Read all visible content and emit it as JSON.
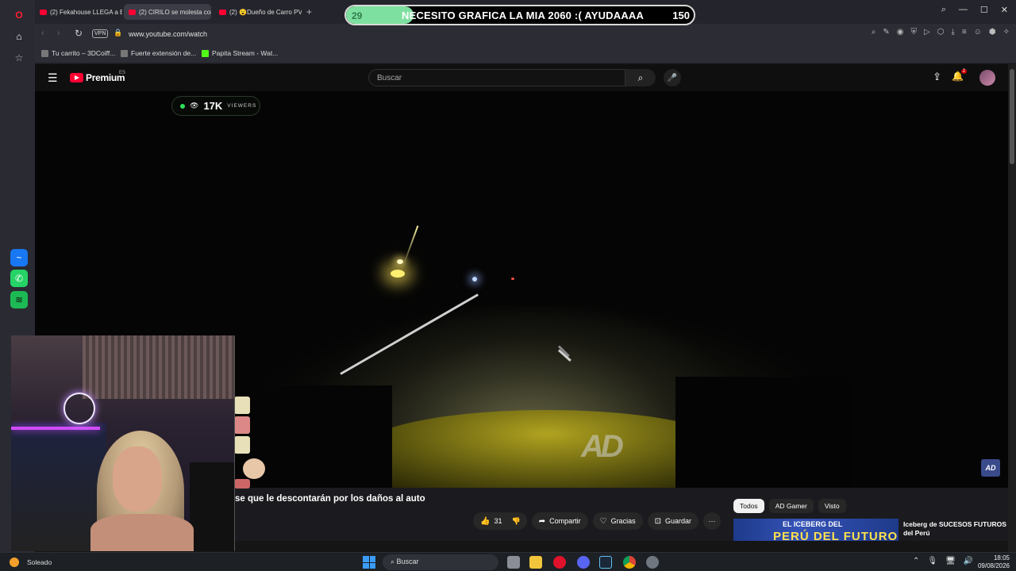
{
  "browser": {
    "tabs": [
      {
        "label": "(2) Fekahouse LLEGA a Bo"
      },
      {
        "label": "(2) CIRILO se molesta con"
      },
      {
        "label": "(2) 😮Dueño de Carro PV"
      }
    ],
    "url": "www.youtube.com/watch",
    "vpn_label": "VPN",
    "bookmarks": [
      {
        "label": "Tu carrito – 3DCoiff..."
      },
      {
        "label": "Fuerte extensión de..."
      },
      {
        "label": "Papita Stream - Wat..."
      }
    ]
  },
  "goal": {
    "current": "29",
    "title": "NECESITO GRAFICA LA MIA 2060 :( AYUDAAAA",
    "target": "150",
    "progress": 0.193
  },
  "youtube": {
    "logo_text": "Premium",
    "region": "ES",
    "search_placeholder": "Buscar",
    "notification_count": "2",
    "video_title": "se que le descontarán por los daños al auto",
    "like_count": "31",
    "actions": {
      "share": "Compartir",
      "thanks": "Gracias",
      "save": "Guardar"
    },
    "chips": [
      {
        "label": "Todos",
        "active": true
      },
      {
        "label": "AD Gamer",
        "active": false
      },
      {
        "label": "Visto",
        "active": false
      }
    ],
    "recommended": {
      "thumb_line1": "EL ICEBERG DEL",
      "thumb_line2": "PERÚ DEL FUTURO",
      "title": "Iceberg de SUCESOS FUTUROS del Perú"
    },
    "watermark": "AD",
    "channel_badge": "AD"
  },
  "stream_overlay": {
    "viewers_count": "17K",
    "viewers_label": "VIEWERS"
  },
  "taskbar": {
    "weather_label": "Soleado",
    "search_label": "Buscar",
    "time": "18:05",
    "date": "09/08/2026"
  },
  "colors": {
    "goal_fill": "#7ee0a0",
    "live_dot": "#2fe05a",
    "yt_red": "#ff0033"
  }
}
